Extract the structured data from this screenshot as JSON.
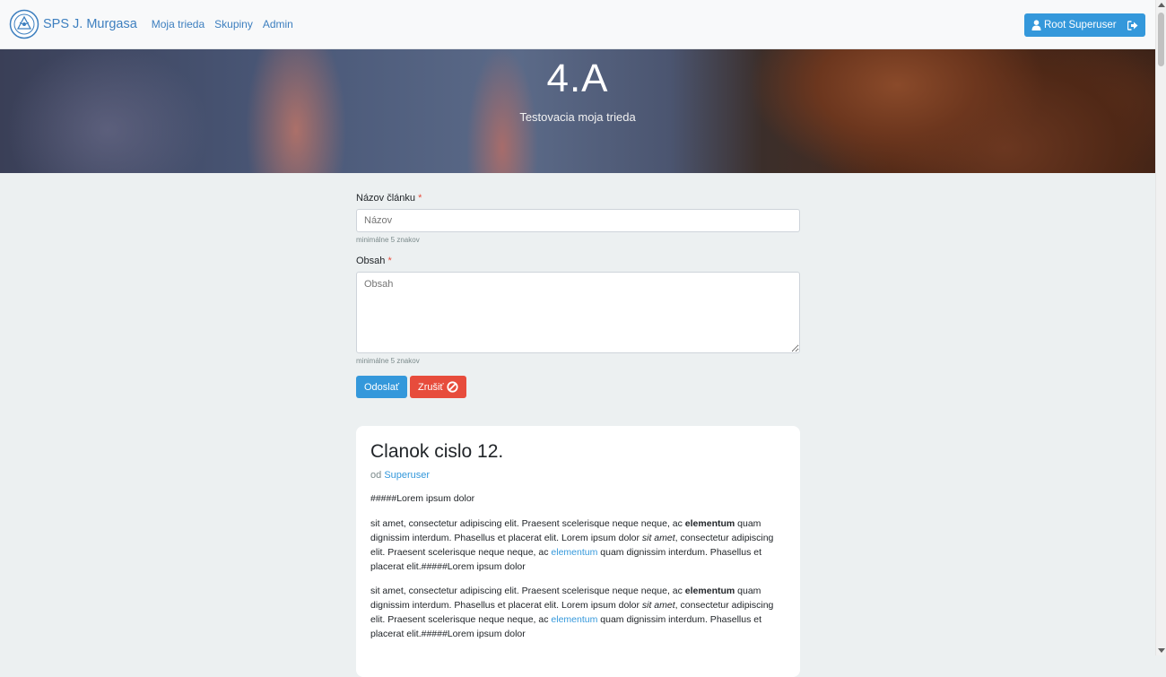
{
  "navbar": {
    "brand": "SPS J. Murgasa",
    "links": [
      "Moja trieda",
      "Skupiny",
      "Admin"
    ],
    "user_button": "Root Superuser"
  },
  "hero": {
    "title": "4.A",
    "subtitle": "Testovacia moja trieda"
  },
  "form": {
    "title_label": "Názov článku",
    "title_placeholder": "Názov",
    "title_help": "minimálne 5 znakov",
    "content_label": "Obsah",
    "content_placeholder": "Obsah",
    "content_help": "minimálne 5 znakov",
    "required_mark": "*",
    "submit_label": "Odoslať",
    "cancel_label": "Zrušiť"
  },
  "article": {
    "title": "Clanok cislo 12.",
    "by_prefix": "od",
    "author": "Superuser",
    "intro": "#####Lorem ipsum dolor",
    "paragraphs": [
      {
        "t1": "sit amet, consectetur adipiscing elit. Praesent scelerisque neque neque, ac ",
        "bold": "elementum",
        "t2": " quam dignissim interdum. Phasellus et placerat elit. Lorem ipsum dolor ",
        "italic": "sit amet",
        "t3": ", consectetur adipiscing elit. Praesent scelerisque neque neque, ac ",
        "link": "elementum",
        "t4": " quam dignissim interdum. Phasellus et placerat elit.#####Lorem ipsum dolor"
      },
      {
        "t1": "sit amet, consectetur adipiscing elit. Praesent scelerisque neque neque, ac ",
        "bold": "elementum",
        "t2": " quam dignissim interdum. Phasellus et placerat elit. Lorem ipsum dolor ",
        "italic": "sit amet",
        "t3": ", consectetur adipiscing elit. Praesent scelerisque neque neque, ac ",
        "link": "elementum",
        "t4": " quam dignissim interdum. Phasellus et placerat elit.#####Lorem ipsum dolor"
      }
    ]
  },
  "icons": {
    "logo": "school-crest-icon",
    "user": "user-icon",
    "logout": "sign-out-icon",
    "cancel": "ban-icon"
  },
  "colors": {
    "primary": "#3498db",
    "danger": "#e74c3c",
    "background": "#ecf0f1",
    "link": "#3d7fbf"
  }
}
